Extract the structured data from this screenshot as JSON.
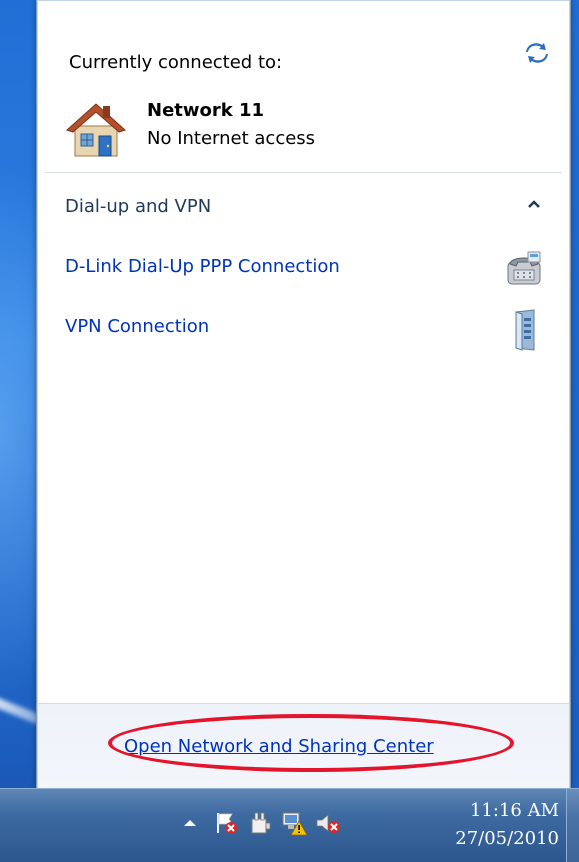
{
  "flyout": {
    "connected_label": "Currently connected to:",
    "network": {
      "name": "Network  11",
      "status": "No Internet access"
    },
    "section": {
      "title": "Dial-up and VPN",
      "collapse_icon": "chevron-up-icon"
    },
    "connections": [
      {
        "label": "D-Link Dial-Up PPP Connection",
        "icon": "dialup-phone-icon"
      },
      {
        "label": "VPN Connection",
        "icon": "vpn-server-icon"
      }
    ],
    "footer_link": "Open Network and Sharing Center",
    "refresh_icon": "refresh-arrows-icon",
    "highlight_color": "#e3142b"
  },
  "taskbar": {
    "tray_icons": [
      "show-hidden-icons-arrow",
      "action-center-flag-icon",
      "power-plug-icon",
      "network-warning-icon",
      "volume-muted-icon"
    ],
    "clock": {
      "time": "11:16 AM",
      "date": "27/05/2010"
    }
  }
}
